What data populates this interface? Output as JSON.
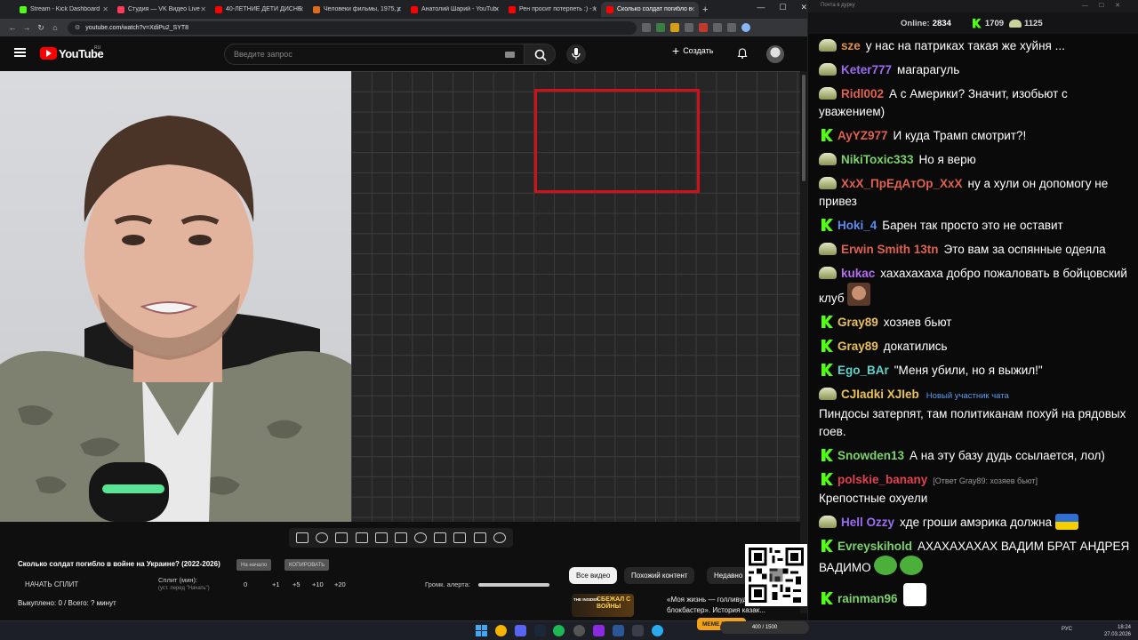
{
  "browser": {
    "tabs": [
      {
        "label": "Stream - Kick Dashboard",
        "color": "#53fc18"
      },
      {
        "label": "Студия — VK Видео Live",
        "color": "#ff3b5c"
      },
      {
        "label": "40-ЛЕТНИЕ ДЕТИ ДИСНЕЯ",
        "color": "#ff0000"
      },
      {
        "label": "Человеки фильмы, 1975, дата",
        "color": "#e06c1a"
      },
      {
        "label": "Анатолий Шарий - YouTube",
        "color": "#ff0000"
      },
      {
        "label": "Рен просит потерпеть :) - Y",
        "color": "#ff0000"
      },
      {
        "label": "Сколько солдат погибло в",
        "color": "#ff0000"
      }
    ],
    "new_tab": "+",
    "url": "youtube.com/watch?v=XdiPu2_SYT8"
  },
  "youtube": {
    "logo_text": "YouTube",
    "region": "RU",
    "search_placeholder": "Введите запрос",
    "create_label": "Создать",
    "video_title": "Сколько солдат погибло в войне на Украине? (2022-2026)",
    "pill_1": "На начало",
    "pill_2": "КОПИРОВАТЬ",
    "start_split": "НАЧАТЬ СПЛИТ",
    "split_label": "Сплит (мин):",
    "split_hint": "(уст. перед \"Начать\")",
    "split_values": [
      "0",
      "+1",
      "+5",
      "+10",
      "+20"
    ],
    "alert_label": "Громк. алерта:",
    "bought": "Выкуплено: 0 / Всего: ? минут",
    "chips": [
      "Все видео",
      "Похожий контент",
      "Недавно"
    ],
    "rec_thumb_text": "СБЕЖАЛ С ВОЙНЫ",
    "rec_thumb_brand": "THE INSIDER",
    "rec_title": "«Моя жизнь — голливудский блокбастер». История казак..."
  },
  "chat": {
    "window_title": "Почта в дурку",
    "online_label": "Online:",
    "online_count": "2834",
    "kick_count": "1709",
    "vk_count": "1125",
    "messages": [
      {
        "platform": "v",
        "user": "sze",
        "color": "#e0914f",
        "text": "у нас на патриках такая же хуйня ..."
      },
      {
        "platform": "v",
        "user": "Keter777",
        "color": "#9b6cf0",
        "text": "магарагуль"
      },
      {
        "platform": "v",
        "user": "Ridl002",
        "color": "#e0614f",
        "text": "А с Америки? Значит, изобьют с уважением)"
      },
      {
        "platform": "k",
        "user": "AyYZ977",
        "color": "#e0614f",
        "text": "И куда Трамп смотрит?!"
      },
      {
        "platform": "v",
        "user": "NikiToxic333",
        "color": "#7bd36a",
        "text": "Но я верю"
      },
      {
        "platform": "v",
        "user": "XxX_ПрЕдАтОр_XxX",
        "color": "#e0614f",
        "text": "ну а хули он допомогу не привез"
      },
      {
        "platform": "k",
        "user": "Hoki_4",
        "color": "#5b8cf0",
        "text": "Барен так просто это не оставит"
      },
      {
        "platform": "v",
        "user": "Erwin Smith 13tn",
        "color": "#e0614f",
        "text": "Это вам за оспянные одеяла"
      },
      {
        "platform": "v",
        "user": "kukac",
        "color": "#b46cf0",
        "text": "хахахахаха добро пожаловать в бойцовский клуб"
      },
      {
        "platform": "k",
        "user": "Gray89",
        "color": "#e8c15a",
        "text": "хозяев бьют"
      },
      {
        "platform": "k",
        "user": "Gray89",
        "color": "#e8c15a",
        "text": "докатились"
      },
      {
        "platform": "k",
        "user": "Ego_BAr",
        "color": "#5ed3c9",
        "text": "\"Меня убили, но я выжил!\""
      },
      {
        "platform": "v",
        "user": "CJIadki XJIeb",
        "color": "#e8c15a",
        "badge": "Новый участник чата",
        "text": "Пиндосы затерпят, там политиканам похуй на рядовых гоев."
      },
      {
        "platform": "k",
        "user": "Snowden13",
        "color": "#7bd36a",
        "text": "А на эту базу дудь ссылается, лол)"
      },
      {
        "platform": "k",
        "user": "polskie_banany",
        "color": "#e0414f",
        "reply": "[Ответ Gray89: хозяев бьют]",
        "text": "Крепостные охуели"
      },
      {
        "platform": "v",
        "user": "Hell Ozzy",
        "color": "#9b6cf0",
        "text": "хде гроши амэрика должна"
      },
      {
        "platform": "k",
        "user": "Evreyskihold",
        "color": "#7bd36a",
        "text": "АХАХАХАХАХ ВАДИМ БРАТ АНДРЕЯ ВАДИМО"
      },
      {
        "platform": "k",
        "user": "rainman96",
        "color": "#7bd36a",
        "text": ""
      }
    ]
  },
  "taskbar": {
    "lang": "РУС",
    "time": "18:24",
    "date": "27.03.2026",
    "counter": "400 / 1500",
    "counter_label": "MEME PARTY"
  }
}
